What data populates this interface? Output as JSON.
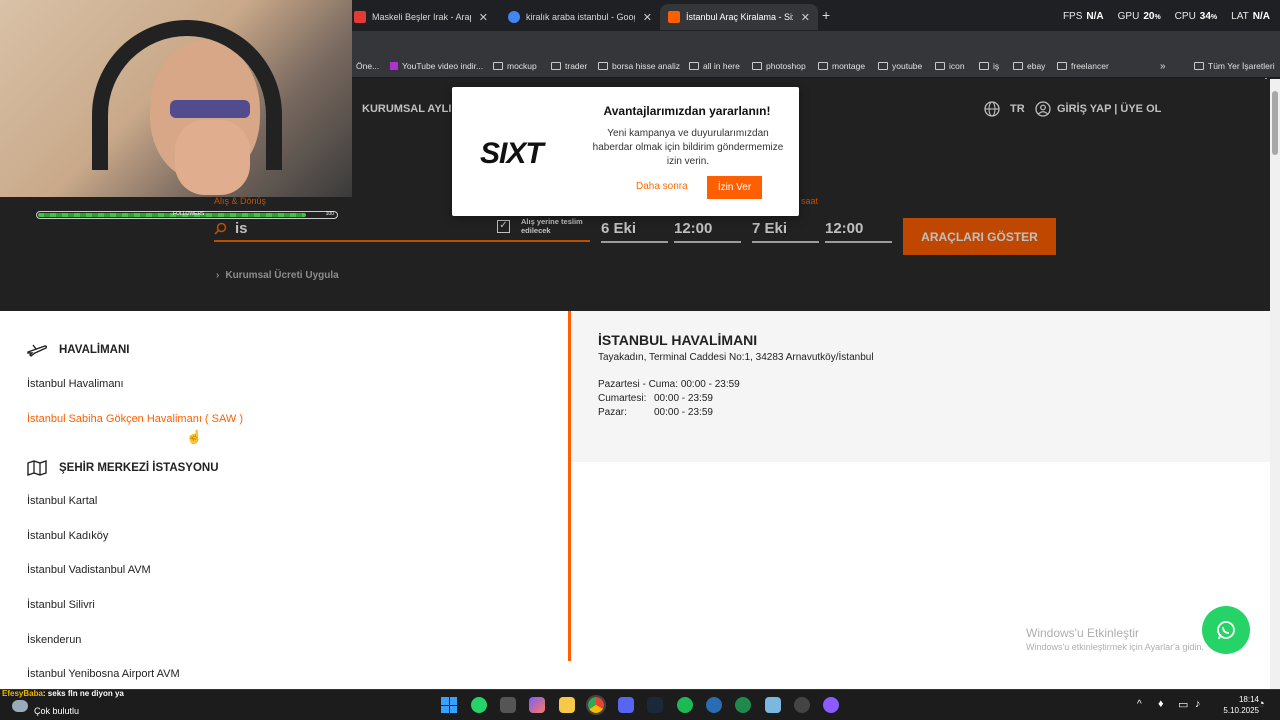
{
  "tabs": [
    {
      "title": "Maskeli Beşler Irak - Arapça Mü",
      "favcolor": "#e53935",
      "active": false
    },
    {
      "title": "kiralık araba istanbul - Google'd",
      "favcolor": "#4285f4",
      "active": false
    },
    {
      "title": "İstanbul Araç Kiralama - Sixt Tü",
      "favcolor": "#ff5f00",
      "active": true
    }
  ],
  "perf": {
    "fps_label": "FPS",
    "fps": "N/A",
    "gpu_label": "GPU",
    "gpu": "20",
    "gpu_unit": "%",
    "cpu_label": "CPU",
    "cpu": "34",
    "cpu_unit": "%",
    "lat_label": "LAT",
    "lat": "N/A"
  },
  "bookmarks": [
    "Öne...",
    "YouTube video indir...",
    "mockup",
    "trader",
    "borsa hisse analiz",
    "all in here",
    "photoshop",
    "montage",
    "youtube",
    "icon",
    "iş",
    "ebay",
    "freelancer",
    "Tüm Yer İşaretleri"
  ],
  "header": {
    "corporate": "KURUMSAL AYLI",
    "lang": "TR",
    "login": "GİRİŞ YAP | ÜYE OL"
  },
  "search": {
    "pickup_label": "Alış & Dönüş",
    "query": "is",
    "same_return": "Alış yerine teslim edilecek",
    "time_label": "saat",
    "pickup_date": "6 Eki",
    "pickup_time": "12:00",
    "return_date": "7 Eki",
    "return_time": "12:00",
    "show_button": "ARAÇLARI GÖSTER",
    "corporate_rate": "Kurumsal Ücreti Uygula"
  },
  "popup": {
    "logo": "SIXT",
    "title": "Avantajlarımızdan yararlanın!",
    "body": "Yeni kampanya ve duyurularımızdan haberdar olmak için bildirim göndermemize izin verin.",
    "later": "Daha sonra",
    "allow": "İzin Ver"
  },
  "airport": {
    "title": "HAVALİMANI",
    "items": [
      "İstanbul Havalimanı",
      "İstanbul Sabiha Gökçen Havalimanı ( SAW )"
    ]
  },
  "city": {
    "title": "ŞEHİR MERKEZİ İSTASYONU",
    "items": [
      "İstanbul Kartal",
      "İstanbul Kadıköy",
      "İstanbul Vadistanbul AVM",
      "İstanbul Silivri",
      "İskenderun",
      "İstanbul Yenibosna Airport AVM"
    ]
  },
  "detail": {
    "name": "İSTANBUL HAVALİMANI",
    "address": "Tayakadın, Terminal Caddesi No:1, 34283 Arnavutköy/İstanbul",
    "hours": [
      {
        "day": "Pazartesi - Cuma:",
        "time": "00:00 - 23:59"
      },
      {
        "day": "Cumartesi:",
        "time": "00:00 - 23:59"
      },
      {
        "day": "Pazar:",
        "time": "00:00 - 23:59"
      }
    ]
  },
  "watermark": {
    "line1": "Windows'u Etkinleştir",
    "line2": "Windows'u etkinleştirmek için Ayarlar'a gidin."
  },
  "stream": {
    "progress_label": "FOLLOWERS",
    "progress_value": "100",
    "progress_fraction": 0.9,
    "chat_user": "EfesyBaba",
    "chat_msg": ": seks fln ne diyon ya"
  },
  "weather": "Çok bulutlu",
  "clock": {
    "time": "18:14",
    "date": "5.10.2025"
  },
  "colors": {
    "brand": "#ff5f00",
    "whatsapp": "#25d366"
  }
}
